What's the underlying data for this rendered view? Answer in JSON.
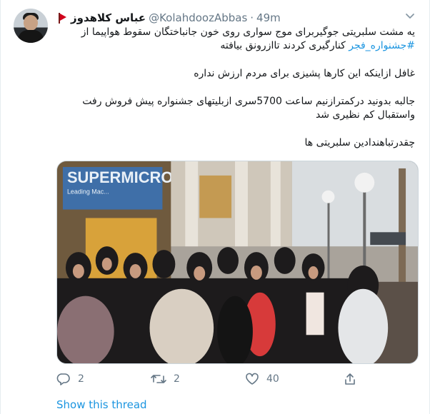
{
  "user": {
    "display_name": "عباس كلاهدوز",
    "handle": "@KolahdoozAbbas",
    "separator": "·",
    "time": "49m"
  },
  "tweet": {
    "line1": "یه مشت سلبریتی جوگیربرای موج سواری روی خون جانباختگان سقوط هواپیما از",
    "hashtag": "#جشنواره_فجر",
    "line2_rest": " کنارگیری کردند تاازرونق بیافته",
    "para2": "غافل ازاینکه این کارها پشیزی برای مردم ارزش نداره",
    "para3": "جالبه بدونید درکمترازنیم ساعت 5700سری ازبلیتهای جشنواره پیش فروش رفت واستقبال کم نظیری شد",
    "para4": "چقدرتباهندادین سلبریتی ها"
  },
  "photo": {
    "store_sign": "SUPERMICRO",
    "store_sub": "Leading Mac..."
  },
  "actions": {
    "reply_count": "2",
    "retweet_count": "2",
    "like_count": "40"
  },
  "show_thread_label": "Show this thread",
  "colors": {
    "link": "#1b95e0",
    "muted": "#657786",
    "text": "#14171a",
    "border": "#e6ecf0"
  }
}
